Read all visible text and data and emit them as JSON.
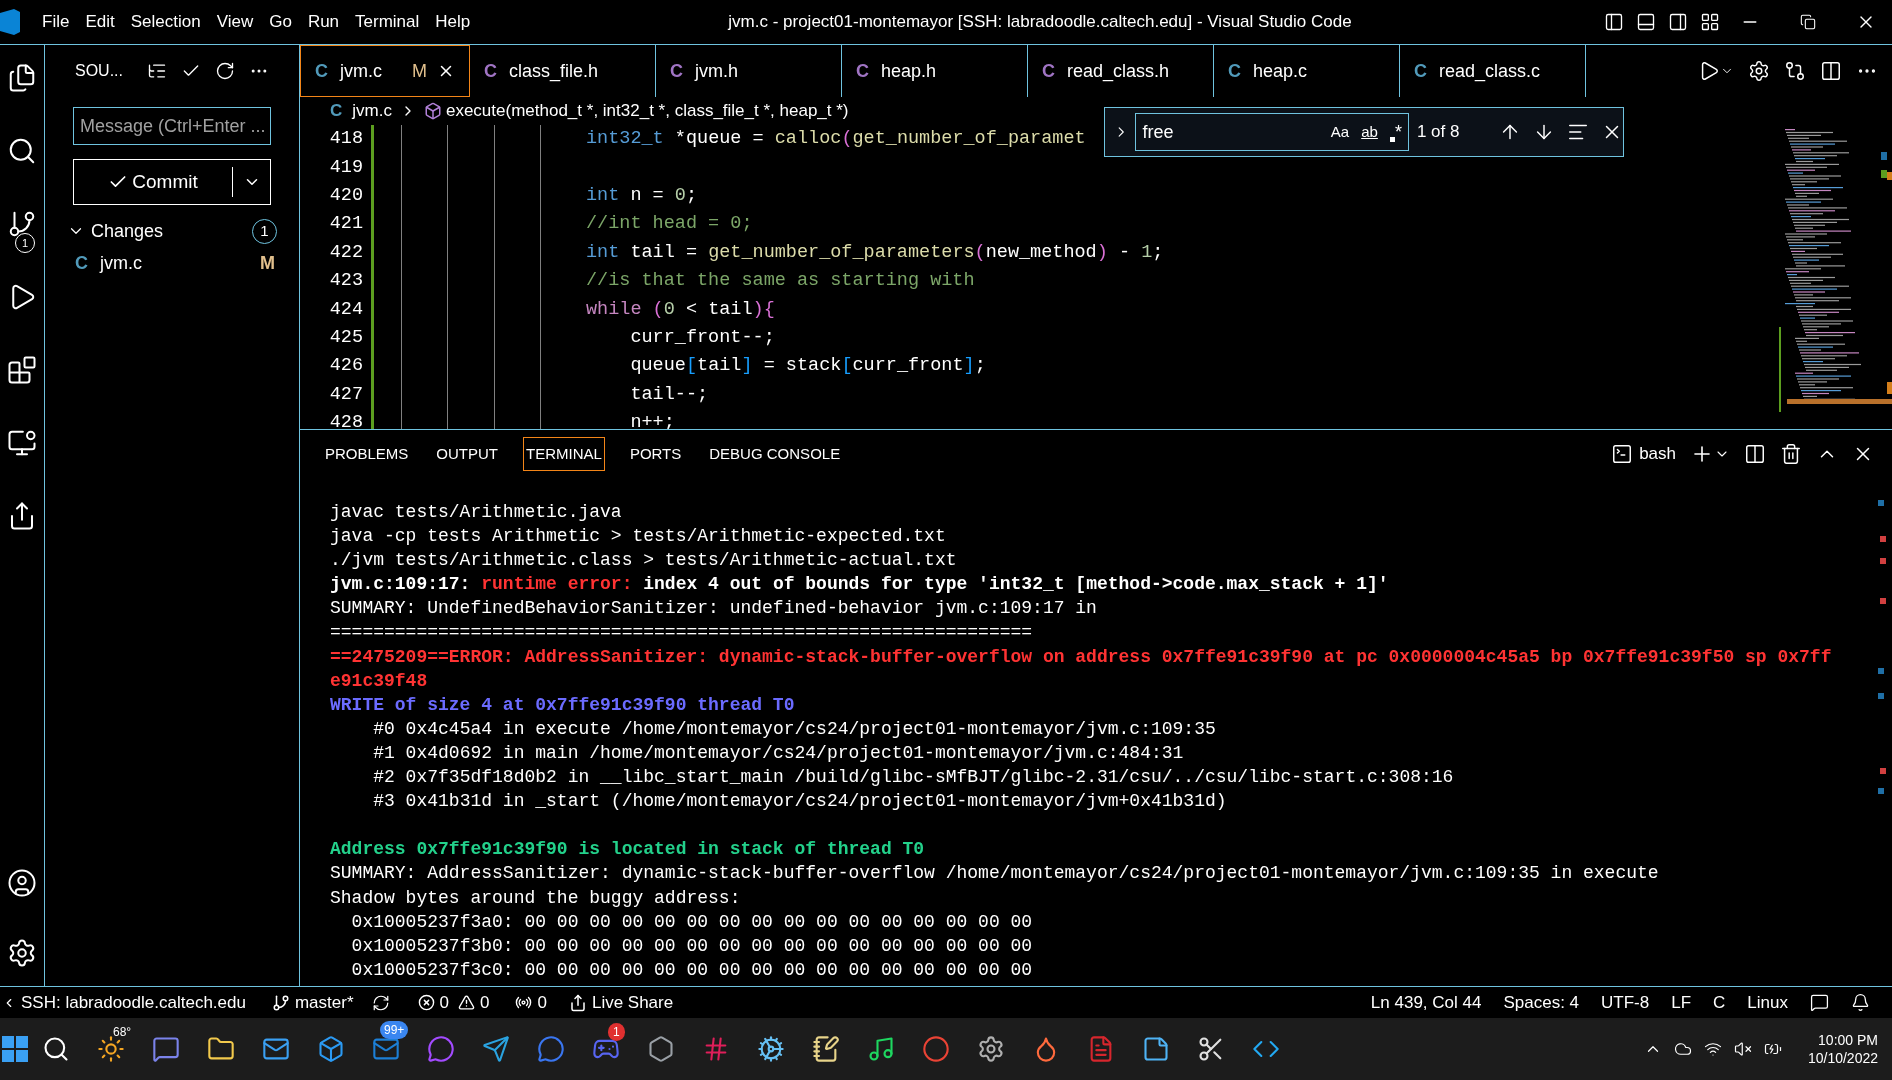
{
  "title_bar": {
    "menu": [
      "File",
      "Edit",
      "Selection",
      "View",
      "Go",
      "Run",
      "Terminal",
      "Help"
    ],
    "title": "jvm.c - project01-montemayor [SSH: labradoodle.caltech.edu] - Visual Studio Code"
  },
  "activity_bar": {
    "source_control_badge": "1"
  },
  "sidebar": {
    "header": "SOU...",
    "message_placeholder": "Message (Ctrl+Enter ...",
    "commit": "Commit",
    "changes": {
      "label": "Changes",
      "count": "1",
      "expanded": true,
      "files": [
        {
          "lang": "C",
          "name": "jvm.c",
          "status": "M"
        }
      ]
    }
  },
  "tabs": [
    {
      "lang": "C",
      "color": "#519aba",
      "label": "jvm.c",
      "status": "M",
      "selected": true
    },
    {
      "lang": "C",
      "color": "#a074c4",
      "label": "class_file.h",
      "selected": false
    },
    {
      "lang": "C",
      "color": "#a074c4",
      "label": "jvm.h",
      "selected": false
    },
    {
      "lang": "C",
      "color": "#a074c4",
      "label": "heap.h",
      "selected": false
    },
    {
      "lang": "C",
      "color": "#a074c4",
      "label": "read_class.h",
      "selected": false
    },
    {
      "lang": "C",
      "color": "#519aba",
      "label": "heap.c",
      "selected": false
    },
    {
      "lang": "C",
      "color": "#519aba",
      "label": "read_class.c",
      "selected": false
    }
  ],
  "breadcrumb": {
    "lang": "C",
    "file": "jvm.c",
    "symbol": "execute(method_t *, int32_t *, class_file_t *, heap_t *)"
  },
  "find": {
    "value": "free",
    "match_case": "Aa",
    "whole_word": "ab",
    "regex": "*",
    "result": "1 of 8"
  },
  "editor": {
    "lines": [
      {
        "number": "418",
        "tokens": [
          {
            "text": "int32_t",
            "kind": "keyword"
          },
          {
            "text": " *queue = ",
            "kind": "plain"
          },
          {
            "text": "calloc",
            "kind": "func"
          },
          {
            "text": "(",
            "kind": "bracket"
          },
          {
            "text": "get_number_of_paramet",
            "kind": "func"
          }
        ]
      },
      {
        "number": "419"
      },
      {
        "number": "420",
        "tokens": [
          {
            "text": "int",
            "kind": "keyword"
          },
          {
            "text": " n = ",
            "kind": "plain"
          },
          {
            "text": "0",
            "kind": "number"
          },
          {
            "text": ";",
            "kind": "plain"
          }
        ]
      },
      {
        "number": "421",
        "tokens": [
          {
            "text": "//int head = 0;",
            "kind": "comment"
          }
        ]
      },
      {
        "number": "422",
        "tokens": [
          {
            "text": "int",
            "kind": "keyword"
          },
          {
            "text": " tail = ",
            "kind": "plain"
          },
          {
            "text": "get_number_of_parameters",
            "kind": "func"
          },
          {
            "text": "(",
            "kind": "bracket"
          },
          {
            "text": "new_method",
            "kind": "plain"
          },
          {
            "text": ")",
            "kind": "bracket"
          },
          {
            "text": " - ",
            "kind": "plain"
          },
          {
            "text": "1",
            "kind": "number"
          },
          {
            "text": ";",
            "kind": "plain"
          }
        ]
      },
      {
        "number": "423",
        "tokens": [
          {
            "text": "//is that the same as starting with",
            "kind": "comment"
          }
        ]
      },
      {
        "number": "424",
        "tokens": [
          {
            "text": "while",
            "kind": "control"
          },
          {
            "text": " (",
            "kind": "bracket"
          },
          {
            "text": "0",
            "kind": "number"
          },
          {
            "text": " < tail",
            "kind": "plain"
          },
          {
            "text": ")",
            "kind": "bracket"
          },
          {
            "text": "{",
            "kind": "bracket"
          }
        ]
      },
      {
        "number": "425",
        "tokens": [
          {
            "text": "    curr_front--;",
            "kind": "plain"
          }
        ]
      },
      {
        "number": "426",
        "tokens": [
          {
            "text": "    queue",
            "kind": "plain"
          },
          {
            "text": "[",
            "kind": "bracket2"
          },
          {
            "text": "tail",
            "kind": "plain"
          },
          {
            "text": "]",
            "kind": "bracket2"
          },
          {
            "text": " = stack",
            "kind": "plain"
          },
          {
            "text": "[",
            "kind": "bracket2"
          },
          {
            "text": "curr_front",
            "kind": "plain"
          },
          {
            "text": "]",
            "kind": "bracket2"
          },
          {
            "text": ";",
            "kind": "plain"
          }
        ]
      },
      {
        "number": "427",
        "tokens": [
          {
            "text": "    tail--;",
            "kind": "plain"
          }
        ]
      },
      {
        "number": "428",
        "tokens": [
          {
            "text": "    n++;",
            "kind": "plain"
          }
        ]
      }
    ]
  },
  "panel": {
    "tabs": [
      {
        "label": "PROBLEMS",
        "selected": false
      },
      {
        "label": "OUTPUT",
        "selected": false
      },
      {
        "label": "TERMINAL",
        "selected": true
      },
      {
        "label": "PORTS",
        "selected": false
      },
      {
        "label": "DEBUG CONSOLE",
        "selected": false
      }
    ],
    "shell": "bash"
  },
  "terminal": {
    "lines": [
      [
        {
          "text": "javac tests/Arithmetic.java",
          "kind": "plain"
        }
      ],
      [
        {
          "text": "java -cp tests Arithmetic > tests/Arithmetic-expected.txt",
          "kind": "plain"
        }
      ],
      [
        {
          "text": "./jvm tests/Arithmetic.class > tests/Arithmetic-actual.txt",
          "kind": "plain"
        }
      ],
      [
        {
          "text": "jvm.c:109:17: ",
          "kind": "bold"
        },
        {
          "text": "runtime error: ",
          "kind": "error"
        },
        {
          "text": "index 4 out of bounds for type 'int32_t [method->code.max_stack + 1]'",
          "kind": "bold"
        }
      ],
      [
        {
          "text": "SUMMARY: UndefinedBehaviorSanitizer: undefined-behavior jvm.c:109:17 in",
          "kind": "plain"
        }
      ],
      [
        {
          "text": "=================================================================",
          "kind": "plain"
        }
      ],
      [
        {
          "text": "==2475209==ERROR: AddressSanitizer: dynamic-stack-buffer-overflow on address 0x7ffe91c39f90 at pc 0x0000004c45a5 bp 0x7ffe91c39f50 sp 0x7ffe91c39f48",
          "kind": "error"
        }
      ],
      [
        {
          "text": "WRITE of size 4 at 0x7ffe91c39f90 thread T0",
          "kind": "info"
        }
      ],
      [
        {
          "text": "    #0 0x4c45a4 in execute /home/montemayor/cs24/project01-montemayor/jvm.c:109:35",
          "kind": "plain"
        }
      ],
      [
        {
          "text": "    #1 0x4d0692 in main /home/montemayor/cs24/project01-montemayor/jvm.c:484:31",
          "kind": "plain"
        }
      ],
      [
        {
          "text": "    #2 0x7f35df18d0b2 in __libc_start_main /build/glibc-sMfBJT/glibc-2.31/csu/../csu/libc-start.c:308:16",
          "kind": "plain"
        }
      ],
      [
        {
          "text": "    #3 0x41b31d in _start (/home/montemayor/cs24/project01-montemayor/jvm+0x41b31d)",
          "kind": "plain"
        }
      ],
      [
        {
          "text": "Address 0x7ffe91c39f90 is located in stack of thread T0",
          "kind": "success"
        }
      ],
      [
        {
          "text": "SUMMARY: AddressSanitizer: dynamic-stack-buffer-overflow /home/montemayor/cs24/project01-montemayor/jvm.c:109:35 in execute",
          "kind": "plain"
        }
      ],
      [
        {
          "text": "Shadow bytes around the buggy address:",
          "kind": "plain"
        }
      ],
      [
        {
          "text": "  0x10005237f3a0: 00 00 00 00 00 00 00 00 00 00 00 00 00 00 00 00",
          "kind": "plain"
        }
      ],
      [
        {
          "text": "  0x10005237f3b0: 00 00 00 00 00 00 00 00 00 00 00 00 00 00 00 00",
          "kind": "plain"
        }
      ],
      [
        {
          "text": "  0x10005237f3c0: 00 00 00 00 00 00 00 00 00 00 00 00 00 00 00 00",
          "kind": "plain"
        }
      ]
    ]
  },
  "status_bar": {
    "remote": "SSH: labradoodle.caltech.edu",
    "branch": "master*",
    "errors": "0",
    "warnings": "0",
    "ports": "0",
    "live_share": "Live Share",
    "position": "Ln 439, Col 44",
    "spaces": "Spaces: 4",
    "encoding": "UTF-8",
    "eol": "LF",
    "language": "C",
    "os": "Linux"
  },
  "taskbar": {
    "weather": "68°",
    "mail_badge": "99+",
    "chat_badge": "1",
    "time": "10:00 PM",
    "date": "10/10/2022"
  }
}
